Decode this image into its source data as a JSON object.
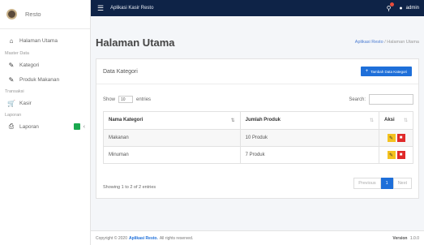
{
  "sidebar": {
    "brand": "Resto",
    "home": "Halaman Utama",
    "sections": [
      {
        "header": "Master Data",
        "items": [
          "Kategori",
          "Produk Makanan"
        ]
      },
      {
        "header": "Transaksi",
        "items": [
          "Kasir"
        ]
      },
      {
        "header": "Laporan",
        "items": [
          "Laporan"
        ]
      }
    ]
  },
  "topbar": {
    "title": "Aplikasi Kasir Resto",
    "user": "admin"
  },
  "page": {
    "title": "Halaman Utama",
    "breadcrumb": [
      "Aplikasi Resto",
      "/",
      "Halaman Utama"
    ]
  },
  "card": {
    "title": "Data Kategori",
    "add_label": "Tambah Data Kategori",
    "show_label": "Show",
    "show_value": "10",
    "entries_label": "entries",
    "search_label": "Search:",
    "columns": [
      "Nama Kategori",
      "Jumlah Produk",
      "Aksi"
    ],
    "rows": [
      {
        "nama": "Makanan",
        "jumlah": "10 Produk"
      },
      {
        "nama": "Minuman",
        "jumlah": "7 Produk"
      }
    ],
    "info": "Showing 1 to 2 of 2 entries",
    "pager": {
      "previous": "Previous",
      "page": "1",
      "next": "Next"
    }
  },
  "footer": {
    "copyright_prefix": "Copyright © 2020",
    "app_name": "Aplikasi Resto.",
    "rights": "All rights reserved.",
    "version_label": "Version",
    "version": "1.0.0"
  },
  "colors": {
    "topbar": "#0e2347",
    "primary": "#1e6fd9",
    "edit": "#f4c21f",
    "delete": "#e02a2a",
    "success": "#1aa84f"
  }
}
